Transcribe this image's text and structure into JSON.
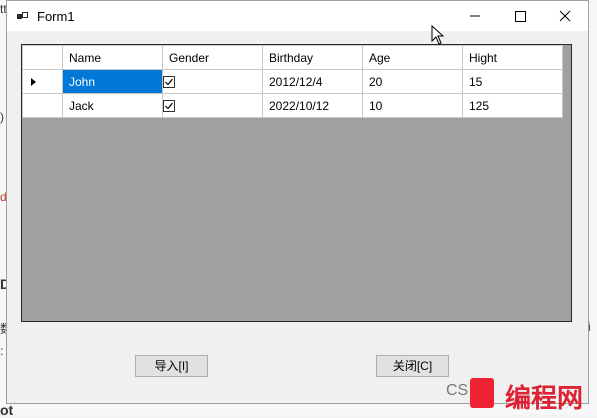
{
  "window": {
    "title": "Form1",
    "minimize_icon": "minimize-icon",
    "maximize_icon": "maximize-icon",
    "close_icon": "close-icon"
  },
  "grid": {
    "columns": [
      "Name",
      "Gender",
      "Birthday",
      "Age",
      "Hight"
    ],
    "rows": [
      {
        "name": "John",
        "gender_checked": true,
        "birthday": "2012/12/4",
        "age": "20",
        "hight": "15",
        "current": true
      },
      {
        "name": "Jack",
        "gender_checked": true,
        "birthday": "2022/10/12",
        "age": "10",
        "hight": "125",
        "current": false
      }
    ],
    "selection_color": "#0078d7",
    "empty_area_color": "#a0a0a0"
  },
  "buttons": {
    "import_label": "导入[I]",
    "close_label": "关闭[C]"
  },
  "background": {
    "frag1": "tt",
    "frag2": ")",
    "frag3": "d",
    "frag4": "D",
    "frag5": "数",
    "frag6": ":",
    "frag7": "ot",
    "frag_right": "i"
  },
  "watermark": {
    "prefix": "CS",
    "brand": "编程网"
  }
}
